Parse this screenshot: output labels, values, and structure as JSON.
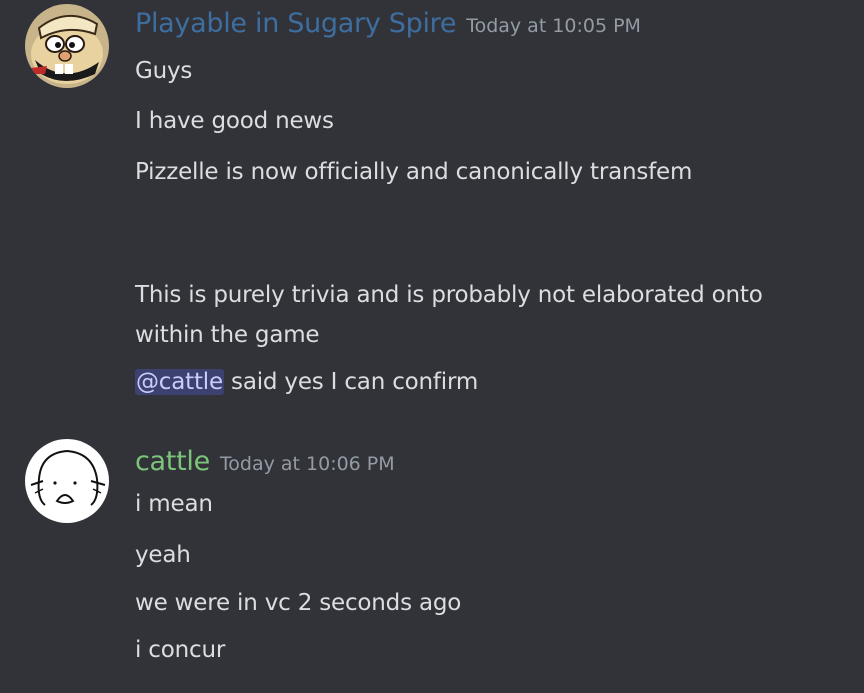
{
  "colors": {
    "background": "#313338",
    "text": "#dbdee1",
    "timestamp": "#949ba4",
    "user1_name": "#3e6ea0",
    "user2_name": "#7cc47a",
    "mention_bg": "#3e4580",
    "mention_text": "#c9cdfb"
  },
  "messages": [
    {
      "author": "Playable in Sugary Spire",
      "timestamp": "Today at 10:05 PM",
      "avatar_icon": "cartoon-chef-avatar-icon",
      "lines": [
        "Guys",
        "I have good news",
        "Pizzelle is now officially and canonically transfem",
        "This is purely trivia and is probably not elaborated onto",
        "within the game"
      ],
      "mention": "@cattle",
      "mention_tail": " said yes I can confirm"
    },
    {
      "author": "cattle",
      "timestamp": "Today at 10:06 PM",
      "avatar_icon": "sketch-face-avatar-icon",
      "lines": [
        "i mean",
        "yeah",
        "we were in vc 2 seconds ago",
        "i concur"
      ]
    }
  ]
}
